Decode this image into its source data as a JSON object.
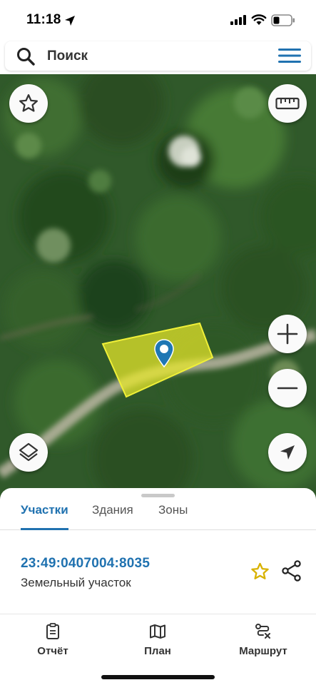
{
  "status_bar": {
    "time": "11:18"
  },
  "search": {
    "placeholder": "Поиск"
  },
  "map": {
    "parcel_highlight_color": "#e9e92a",
    "pin_color": "#1f77b4"
  },
  "tabs": [
    {
      "label": "Участки",
      "active": true
    },
    {
      "label": "Здания",
      "active": false
    },
    {
      "label": "Зоны",
      "active": false
    }
  ],
  "parcel": {
    "cadastral_number": "23:49:0407004:8035",
    "type": "Земельный участок"
  },
  "bottom_nav": [
    {
      "label": "Отчёт",
      "icon": "report-icon"
    },
    {
      "label": "План",
      "icon": "map-plan-icon"
    },
    {
      "label": "Маршрут",
      "icon": "route-icon"
    }
  ],
  "colors": {
    "accent": "#2072b0",
    "star": "#d8b200"
  }
}
